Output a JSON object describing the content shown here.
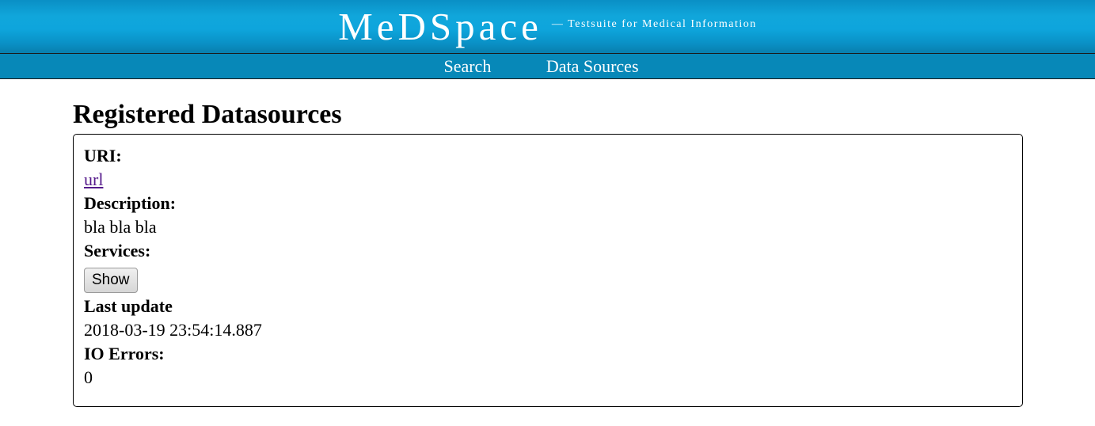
{
  "header": {
    "title": "MeDSpace",
    "tagline": "— Testsuite for Medical Information"
  },
  "nav": {
    "items": [
      "Search",
      "Data Sources"
    ]
  },
  "main": {
    "heading": "Registered Datasources",
    "datasource": {
      "uri_label": "URI:",
      "uri_value": "url",
      "description_label": "Description:",
      "description_value": "bla bla bla",
      "services_label": "Services:",
      "services_button": "Show",
      "last_update_label": "Last update",
      "last_update_value": "2018-03-19 23:54:14.887",
      "io_errors_label": "IO Errors:",
      "io_errors_value": "0"
    }
  },
  "colors": {
    "header_blue": "#0ea5dc",
    "nav_blue": "#0788b8",
    "link_visited": "#551a8b"
  }
}
